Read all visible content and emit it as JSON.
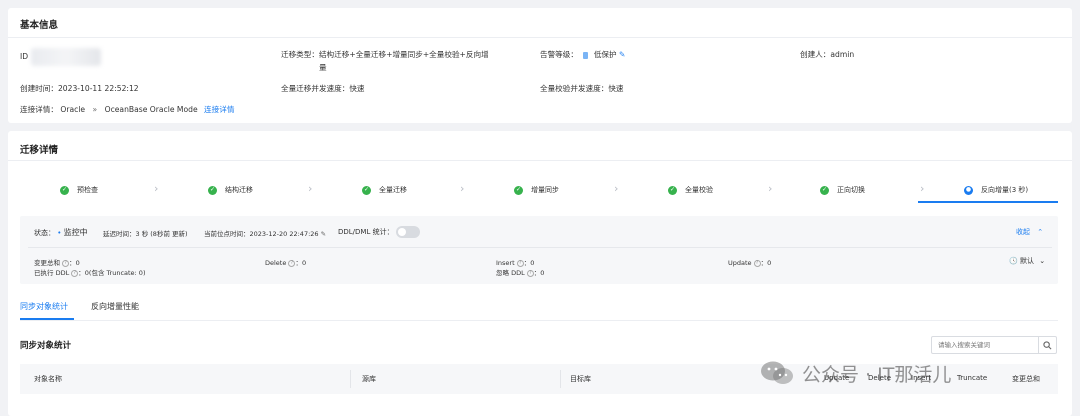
{
  "basic_info": {
    "title": "基本信息",
    "id_label": "ID",
    "migration_type": "迁移类型：结构迁移+全量迁移+增量同步+全量校验+反向增",
    "migration_type_wrap": "量",
    "alert_label": "告警等级：",
    "alert_value": "低保护",
    "creator": "创建人：admin",
    "created_time": "创建时间：2023-10-11 22:52:12",
    "full_migration_speed": "全量迁移并发速度：快速",
    "full_check_speed": "全量校验并发速度：快速",
    "connection_label": "连接详情：",
    "source_db": "Oracle",
    "arrow": "»",
    "target_db": "OceanBase Oracle Mode",
    "connection_link": "连接详情"
  },
  "migration_detail": {
    "title": "迁移详情",
    "steps": [
      {
        "label": "预检查",
        "status": "done"
      },
      {
        "label": "结构迁移",
        "status": "done"
      },
      {
        "label": "全量迁移",
        "status": "done"
      },
      {
        "label": "增量同步",
        "status": "done"
      },
      {
        "label": "全量校验",
        "status": "done"
      },
      {
        "label": "正向切换",
        "status": "done"
      },
      {
        "label": "反向增量(3 秒)",
        "status": "running"
      }
    ],
    "status_label": "状态：",
    "status_value": "监控中",
    "delay": "延迟时间：3 秒 (8秒前 更新)",
    "checkpoint": "当前位点时间：2023-12-20 22:47:26",
    "ddl_dml_label": "DDL/DML 统计：",
    "collapse": "收起",
    "stats": {
      "change_total": "变更总和",
      "change_total_value": "：0",
      "executed_ddl": "已执行 DDL",
      "executed_ddl_value": "：0(包含 Truncate: 0)",
      "delete": "Delete",
      "delete_value": "：0",
      "insert": "Insert",
      "insert_value": "：0",
      "ignored_ddl": "忽略 DDL",
      "ignored_ddl_value": "：0",
      "update": "Update",
      "update_value": "：0",
      "default": "默认"
    }
  },
  "tabs": [
    {
      "label": "同步对象统计",
      "active": true
    },
    {
      "label": "反向增量性能",
      "active": false
    }
  ],
  "object_stats": {
    "title": "同步对象统计",
    "search_placeholder": "请输入搜索关键词",
    "columns": [
      "对象名称",
      "源库",
      "目标库",
      "Update",
      "Delete",
      "Insert",
      "Truncate",
      "变更总和"
    ]
  },
  "watermark": "公众号 · IT那活儿",
  "colors": {
    "accent": "#1a7cf0",
    "success": "#37b24d"
  }
}
